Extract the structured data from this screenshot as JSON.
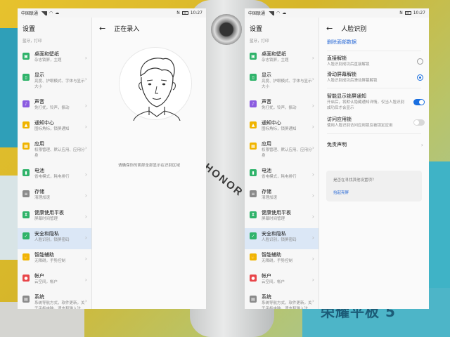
{
  "status": {
    "carrier": "中国联通",
    "time": "10:27"
  },
  "settings": {
    "title": "设置",
    "partial_sub": "蓝牙，打印",
    "items": [
      {
        "name": "桌面和壁纸",
        "sub": "杂志锁屏，主题",
        "color": "#2fb36a",
        "icon": "image-icon"
      },
      {
        "name": "显示",
        "sub": "亮度、护眼模式、字体与显示大小",
        "color": "#2fb36a",
        "icon": "display-icon"
      },
      {
        "name": "声音",
        "sub": "免打扰，铃声，振动",
        "color": "#8b5be0",
        "icon": "sound-icon"
      },
      {
        "name": "通知中心",
        "sub": "图标角标，锁屏通知",
        "color": "#f0b400",
        "icon": "bell-icon"
      },
      {
        "name": "应用",
        "sub": "权限管理、默认应用、应用分身",
        "color": "#f0b400",
        "icon": "apps-icon"
      },
      {
        "name": "电池",
        "sub": "省电模式，耗电排行",
        "color": "#2fb36a",
        "icon": "battery-icon"
      },
      {
        "name": "存储",
        "sub": "清理加速",
        "color": "#8a8a8a",
        "icon": "storage-icon"
      },
      {
        "name": "健康使用平板",
        "sub": "屏幕时间管理",
        "color": "#2fb36a",
        "icon": "hourglass-icon"
      },
      {
        "name": "安全和隐私",
        "sub": "人脸识别，锁屏密码",
        "color": "#2fb36a",
        "icon": "shield-icon"
      },
      {
        "name": "智能辅助",
        "sub": "无障碍，手势控制",
        "color": "#f0b400",
        "icon": "hand-icon"
      },
      {
        "name": "帐户",
        "sub": "云空间，帐户",
        "color": "#e8464a",
        "icon": "account-icon"
      },
      {
        "name": "系统",
        "sub": "系统导航方式，软件更新，关于平板电脑，语言和输入法",
        "color": "#8a8a8a",
        "icon": "system-icon"
      }
    ]
  },
  "left_detail": {
    "title": "正在录入",
    "hint": "请确保你的面部全部显示在识别区域"
  },
  "right_detail": {
    "title": "人脸识别",
    "delete_link": "删除面部数据",
    "options": [
      {
        "title": "直接解锁",
        "sub": "人脸识别成功后直接解锁",
        "control": "radio",
        "on": false
      },
      {
        "title": "滑动屏幕解锁",
        "sub": "人脸识别成功后滑动屏幕解锁",
        "control": "radio",
        "on": true
      },
      {
        "title": "智能显示锁屏通知",
        "sub": "开启后，将默认隐藏通知详情，仅当人脸识别成功后才会显示",
        "control": "toggle",
        "on": true
      },
      {
        "title": "访问应用锁",
        "sub": "使用人脸识别访问应用锁及被锁定应用",
        "control": "toggle",
        "on": false
      }
    ],
    "disclaimer": "免责声明",
    "card_question": "是否在寻找其他设置项？",
    "card_link": "抬起亮屏"
  },
  "background": {
    "logo_text": "HONOR",
    "product_text": "荣耀平板 5"
  }
}
